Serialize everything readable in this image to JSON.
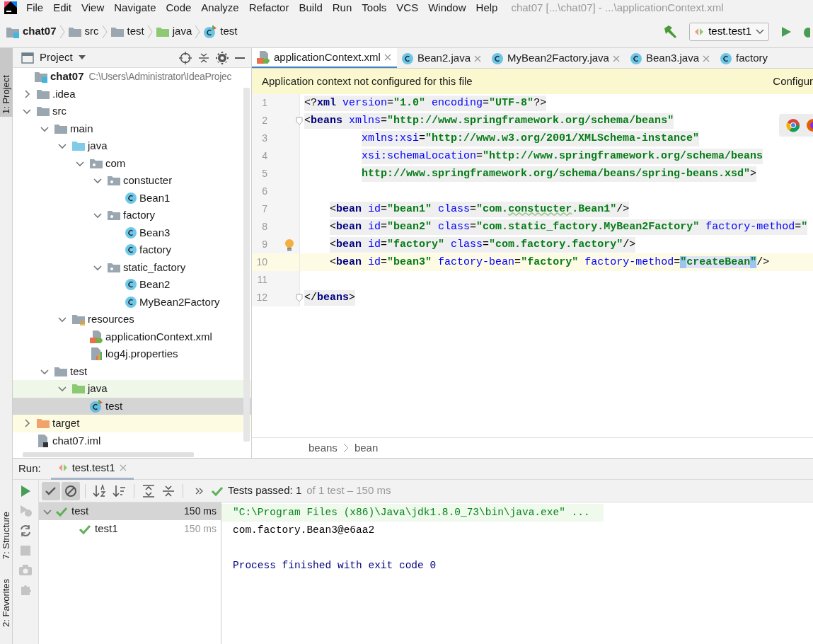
{
  "menu": [
    "File",
    "Edit",
    "View",
    "Navigate",
    "Code",
    "Analyze",
    "Refactor",
    "Build",
    "Run",
    "Tools",
    "VCS",
    "Window",
    "Help"
  ],
  "window": {
    "title": "chat07 [...\\chat07] - ...\\applicationContext.xml"
  },
  "breadcrumbs": [
    {
      "label": "chat07",
      "kind": "module"
    },
    {
      "label": "src",
      "kind": "folder"
    },
    {
      "label": "test",
      "kind": "folder"
    },
    {
      "label": "java",
      "kind": "test-root"
    },
    {
      "label": "test",
      "kind": "test-class"
    }
  ],
  "run_config": {
    "label": "test.test1"
  },
  "tool_stripe": [
    {
      "label": "1: Project",
      "selected": true
    },
    {
      "label": "7: Structure",
      "selected": false
    },
    {
      "label": "2: Favorites",
      "selected": false
    }
  ],
  "project": {
    "title": "Project",
    "tree": [
      {
        "label": "chat07",
        "hint": "C:\\Users\\Administrator\\IdeaProjec",
        "kind": "module",
        "selected": false,
        "children": [
          {
            "label": ".idea",
            "kind": "folder",
            "expanded": false,
            "selected": false
          },
          {
            "label": "src",
            "kind": "folder",
            "expanded": true,
            "selected": false,
            "children": [
              {
                "label": "main",
                "kind": "folder",
                "expanded": true,
                "selected": false,
                "children": [
                  {
                    "label": "java",
                    "kind": "source-root",
                    "expanded": true,
                    "selected": false,
                    "children": [
                      {
                        "label": "com",
                        "kind": "package",
                        "expanded": true,
                        "selected": false,
                        "children": [
                          {
                            "label": "constucter",
                            "kind": "package",
                            "expanded": true,
                            "selected": false,
                            "children": [
                              {
                                "label": "Bean1",
                                "kind": "class",
                                "selected": false
                              }
                            ]
                          },
                          {
                            "label": "factory",
                            "kind": "package",
                            "expanded": true,
                            "selected": false,
                            "children": [
                              {
                                "label": "Bean3",
                                "kind": "class",
                                "selected": false
                              },
                              {
                                "label": "factory",
                                "kind": "class",
                                "selected": false
                              }
                            ]
                          },
                          {
                            "label": "static_factory",
                            "kind": "package",
                            "expanded": true,
                            "selected": false,
                            "children": [
                              {
                                "label": "Bean2",
                                "kind": "class",
                                "selected": false
                              },
                              {
                                "label": "MyBean2Factory",
                                "kind": "class",
                                "selected": false
                              }
                            ]
                          }
                        ]
                      }
                    ]
                  },
                  {
                    "label": "resources",
                    "kind": "resources-root",
                    "expanded": true,
                    "selected": false,
                    "children": [
                      {
                        "label": "applicationContext.xml",
                        "kind": "xml",
                        "selected": false
                      },
                      {
                        "label": "log4j.properties",
                        "kind": "properties",
                        "selected": false
                      }
                    ]
                  }
                ]
              },
              {
                "label": "test",
                "kind": "folder",
                "expanded": true,
                "selected": false,
                "children": [
                  {
                    "label": "java",
                    "kind": "test-root",
                    "expanded": true,
                    "selected": false,
                    "children": [
                      {
                        "label": "test",
                        "kind": "test-class",
                        "selected": true
                      }
                    ]
                  }
                ]
              }
            ]
          },
          {
            "label": "target",
            "kind": "excluded",
            "expanded": false,
            "selected": false
          },
          {
            "label": "chat07.iml",
            "kind": "iml",
            "selected": false
          }
        ]
      }
    ]
  },
  "editor": {
    "tabs": [
      {
        "label": "applicationContext.xml",
        "kind": "xml",
        "selected": true,
        "close": true
      },
      {
        "label": "Bean2.java",
        "kind": "class",
        "selected": false,
        "close": true
      },
      {
        "label": "MyBean2Factory.java",
        "kind": "class",
        "selected": false,
        "close": true
      },
      {
        "label": "Bean3.java",
        "kind": "class",
        "selected": false,
        "close": true
      },
      {
        "label": "factory",
        "kind": "class",
        "selected": false,
        "close": false
      }
    ],
    "banner": {
      "message": "Application context not configured for this file",
      "action": "Configur"
    },
    "lines": [
      {
        "number": "1",
        "kind": "top",
        "shaded": true,
        "current": false,
        "fold": false,
        "bulb": false,
        "tokens": [
          {
            "kind": "punct",
            "text": "<?"
          },
          {
            "kind": "tag",
            "text": "xml"
          },
          {
            "kind": "attr",
            "text": " version"
          },
          {
            "kind": "punct",
            "text": "="
          },
          {
            "kind": "value",
            "text": "\"1.0\""
          },
          {
            "kind": "attr",
            "text": " encoding"
          },
          {
            "kind": "punct",
            "text": "="
          },
          {
            "kind": "value",
            "text": "\"UTF-8\""
          },
          {
            "kind": "punct",
            "text": "?>"
          }
        ]
      },
      {
        "number": "2",
        "kind": "top",
        "shaded": true,
        "current": false,
        "fold": true,
        "bulb": false,
        "tokens": [
          {
            "kind": "punct",
            "text": "<"
          },
          {
            "kind": "tag",
            "text": "beans"
          },
          {
            "kind": "attr",
            "text": " xmlns"
          },
          {
            "kind": "punct",
            "text": "="
          },
          {
            "kind": "value",
            "text": "\"http://www.springframework.org/schema/beans\""
          }
        ]
      },
      {
        "number": "3",
        "kind": "continuation",
        "shaded": true,
        "current": false,
        "fold": false,
        "bulb": false,
        "tokens": [
          {
            "kind": "attr",
            "text": "xmlns:xsi"
          },
          {
            "kind": "punct",
            "text": "="
          },
          {
            "kind": "value",
            "text": "\"http://www.w3.org/2001/XMLSchema-instance\""
          }
        ]
      },
      {
        "number": "4",
        "kind": "continuation",
        "shaded": true,
        "current": false,
        "fold": false,
        "bulb": false,
        "tokens": [
          {
            "kind": "attr",
            "text": "xsi:schemaLocation"
          },
          {
            "kind": "punct",
            "text": "="
          },
          {
            "kind": "value",
            "text": "\"http://www.springframework.org/schema/beans"
          }
        ]
      },
      {
        "number": "5",
        "kind": "continuation",
        "shaded": true,
        "current": false,
        "fold": false,
        "bulb": false,
        "tokens": [
          {
            "kind": "value",
            "text": "http://www.springframework.org/schema/beans/spring-beans.xsd\""
          },
          {
            "kind": "punct",
            "text": ">"
          }
        ]
      },
      {
        "number": "6",
        "kind": "top",
        "shaded": false,
        "current": false,
        "fold": false,
        "bulb": false
      },
      {
        "number": "7",
        "kind": "child",
        "shaded": true,
        "current": false,
        "fold": false,
        "bulb": false,
        "tokens": [
          {
            "kind": "punct",
            "text": "<"
          },
          {
            "kind": "tag",
            "text": "bean"
          },
          {
            "kind": "attr",
            "text": " id"
          },
          {
            "kind": "punct",
            "text": "="
          },
          {
            "kind": "value",
            "text": "\"bean1\""
          },
          {
            "kind": "attr",
            "text": " class"
          },
          {
            "kind": "punct",
            "text": "="
          },
          {
            "kind": "value",
            "text": "\"com."
          },
          {
            "kind": "typo",
            "text": "constucter"
          },
          {
            "kind": "value",
            "text": ".Bean1\""
          },
          {
            "kind": "punct",
            "text": "/>"
          }
        ]
      },
      {
        "number": "8",
        "kind": "child",
        "shaded": true,
        "current": false,
        "fold": false,
        "bulb": false,
        "tokens": [
          {
            "kind": "punct",
            "text": "<"
          },
          {
            "kind": "tag",
            "text": "bean"
          },
          {
            "kind": "attr",
            "text": " id"
          },
          {
            "kind": "punct",
            "text": "="
          },
          {
            "kind": "value",
            "text": "\"bean2\""
          },
          {
            "kind": "attr",
            "text": " class"
          },
          {
            "kind": "punct",
            "text": "="
          },
          {
            "kind": "value",
            "text": "\"com.static_factory.MyBean2Factory\""
          },
          {
            "kind": "attr",
            "text": " factory-method"
          },
          {
            "kind": "punct",
            "text": "="
          },
          {
            "kind": "value",
            "text": "\""
          }
        ]
      },
      {
        "number": "9",
        "kind": "child",
        "shaded": true,
        "current": false,
        "fold": false,
        "bulb": true,
        "tokens": [
          {
            "kind": "punct",
            "text": "<"
          },
          {
            "kind": "tag",
            "text": "bean"
          },
          {
            "kind": "attr",
            "text": " id"
          },
          {
            "kind": "punct",
            "text": "="
          },
          {
            "kind": "value",
            "text": "\"factory\""
          },
          {
            "kind": "attr",
            "text": " class"
          },
          {
            "kind": "punct",
            "text": "="
          },
          {
            "kind": "value",
            "text": "\"com.factory.factory\""
          },
          {
            "kind": "punct",
            "text": "/>"
          }
        ]
      },
      {
        "number": "10",
        "kind": "child",
        "shaded": false,
        "current": true,
        "fold": false,
        "bulb": false,
        "tokens": [
          {
            "kind": "punct",
            "text": "<"
          },
          {
            "kind": "tag",
            "text": "bean"
          },
          {
            "kind": "attr",
            "text": " id"
          },
          {
            "kind": "punct",
            "text": "="
          },
          {
            "kind": "value",
            "text": "\"bean3\""
          },
          {
            "kind": "attr",
            "text": " factory-bean"
          },
          {
            "kind": "punct",
            "text": "="
          },
          {
            "kind": "value",
            "text": "\"factory\""
          },
          {
            "kind": "attr",
            "text": " factory-method"
          },
          {
            "kind": "punct",
            "text": "="
          },
          {
            "kind": "match",
            "text": "\""
          },
          {
            "kind": "marked",
            "text": "createBean"
          },
          {
            "kind": "match",
            "text": "\""
          },
          {
            "kind": "punct",
            "text": "/>"
          }
        ]
      },
      {
        "number": "11",
        "kind": "top",
        "shaded": false,
        "current": false,
        "fold": false,
        "bulb": false
      },
      {
        "number": "12",
        "kind": "top",
        "shaded": true,
        "current": false,
        "fold": true,
        "bulb": false,
        "tokens": [
          {
            "kind": "punct",
            "text": "</"
          },
          {
            "kind": "tag",
            "text": "beans"
          },
          {
            "kind": "punct",
            "text": ">"
          }
        ]
      }
    ],
    "path": [
      "beans",
      "bean"
    ]
  },
  "run": {
    "label": "Run:",
    "tabs": [
      {
        "label": "test.test1",
        "selected": true
      }
    ],
    "side_tools": [
      {
        "kind": "run",
        "disabled": false
      },
      {
        "kind": "rerun-failed",
        "disabled": true
      },
      {
        "kind": "toggle-auto",
        "disabled": false
      },
      {
        "kind": "stop",
        "disabled": true
      },
      {
        "kind": "camera",
        "disabled": true
      },
      {
        "kind": "settings",
        "disabled": true
      }
    ],
    "toolbar": [
      {
        "kind": "show-passed",
        "pressed": true
      },
      {
        "kind": "show-ignored",
        "pressed": true
      },
      {
        "kind": "sort-alpha",
        "pressed": false
      },
      {
        "kind": "sort-duration",
        "pressed": false
      },
      {
        "kind": "expand-all",
        "pressed": false
      },
      {
        "kind": "collapse-all",
        "pressed": false
      }
    ],
    "status": "Tests passed: 1",
    "status_detail": "of 1 test – 150 ms",
    "tests": [
      {
        "label": "test",
        "time": "150 ms",
        "passed": true,
        "selected": true,
        "expanded": true,
        "children": [
          {
            "label": "test1",
            "time": "150 ms",
            "passed": true,
            "selected": false
          }
        ]
      }
    ],
    "console": [
      {
        "kind": "command",
        "text": "\"C:\\Program Files (x86)\\Java\\jdk1.8.0_73\\bin\\java.exe\" ..."
      },
      {
        "kind": "stdout",
        "text": "com.factory.Bean3@e6aa2"
      },
      {
        "kind": "system",
        "text": "Process finished with exit code 0"
      }
    ]
  }
}
